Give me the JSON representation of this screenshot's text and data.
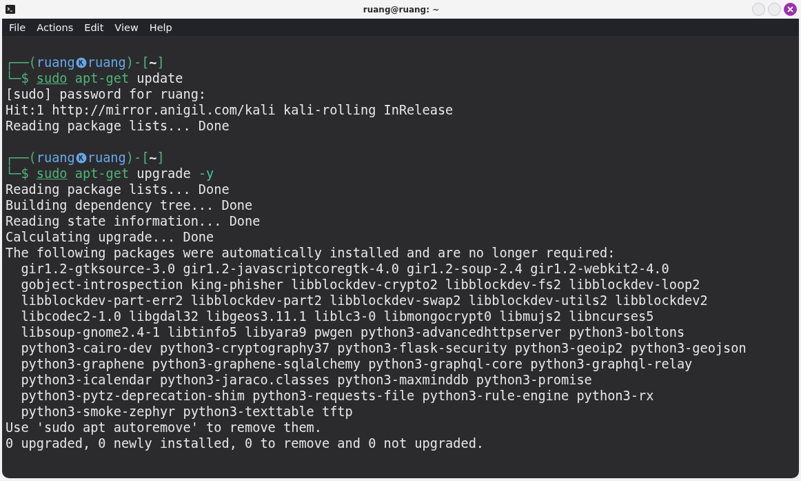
{
  "window": {
    "title": "ruang@ruang: ~"
  },
  "menu": [
    {
      "label": "File"
    },
    {
      "label": "Actions"
    },
    {
      "label": "Edit"
    },
    {
      "label": "View"
    },
    {
      "label": "Help"
    }
  ],
  "terminal": {
    "lines": [
      {
        "kind": "blank"
      },
      {
        "kind": "prompt",
        "open": "┌──(",
        "user": "ruang",
        "host": "ruang",
        "sep": ")-[",
        "directory": "~",
        "close": "]",
        "lead": "└─$",
        "tokens": [
          {
            "kind": "precommand",
            "text": "sudo"
          },
          {
            "kind": "command",
            "text": "apt-get"
          },
          {
            "kind": "argument",
            "text": "update"
          }
        ]
      },
      {
        "kind": "output",
        "text": "[sudo] password for ruang:"
      },
      {
        "kind": "output",
        "text": "Hit:1 http://mirror.anigil.com/kali kali-rolling InRelease"
      },
      {
        "kind": "output",
        "text": "Reading package lists... Done"
      },
      {
        "kind": "blank"
      },
      {
        "kind": "prompt",
        "open": "┌──(",
        "user": "ruang",
        "host": "ruang",
        "sep": ")-[",
        "directory": "~",
        "close": "]",
        "lead": "└─$",
        "tokens": [
          {
            "kind": "precommand",
            "text": "sudo"
          },
          {
            "kind": "command",
            "text": "apt-get"
          },
          {
            "kind": "argument",
            "text": "upgrade"
          },
          {
            "kind": "option",
            "text": "-y"
          }
        ]
      },
      {
        "kind": "output",
        "text": "Reading package lists... Done"
      },
      {
        "kind": "output",
        "text": "Building dependency tree... Done"
      },
      {
        "kind": "output",
        "text": "Reading state information... Done"
      },
      {
        "kind": "output",
        "text": "Calculating upgrade... Done"
      },
      {
        "kind": "output",
        "text": "The following packages were automatically installed and are no longer required:"
      },
      {
        "kind": "output",
        "text": "  gir1.2-gtksource-3.0 gir1.2-javascriptcoregtk-4.0 gir1.2-soup-2.4 gir1.2-webkit2-4.0"
      },
      {
        "kind": "output",
        "text": "  gobject-introspection king-phisher libblockdev-crypto2 libblockdev-fs2 libblockdev-loop2"
      },
      {
        "kind": "output",
        "text": "  libblockdev-part-err2 libblockdev-part2 libblockdev-swap2 libblockdev-utils2 libblockdev2"
      },
      {
        "kind": "output",
        "text": "  libcodec2-1.0 libgdal32 libgeos3.11.1 liblc3-0 libmongocrypt0 libmujs2 libncurses5"
      },
      {
        "kind": "output",
        "text": "  libsoup-gnome2.4-1 libtinfo5 libyara9 pwgen python3-advancedhttpserver python3-boltons"
      },
      {
        "kind": "output",
        "text": "  python3-cairo-dev python3-cryptography37 python3-flask-security python3-geoip2 python3-geojson"
      },
      {
        "kind": "output",
        "text": "  python3-graphene python3-graphene-sqlalchemy python3-graphql-core python3-graphql-relay"
      },
      {
        "kind": "output",
        "text": "  python3-icalendar python3-jaraco.classes python3-maxminddb python3-promise"
      },
      {
        "kind": "output",
        "text": "  python3-pytz-deprecation-shim python3-requests-file python3-rule-engine python3-rx"
      },
      {
        "kind": "output",
        "text": "  python3-smoke-zephyr python3-texttable tftp"
      },
      {
        "kind": "output",
        "text": "Use 'sudo apt autoremove' to remove them."
      },
      {
        "kind": "output",
        "text": "0 upgraded, 0 newly installed, 0 to remove and 0 not upgraded."
      }
    ]
  }
}
